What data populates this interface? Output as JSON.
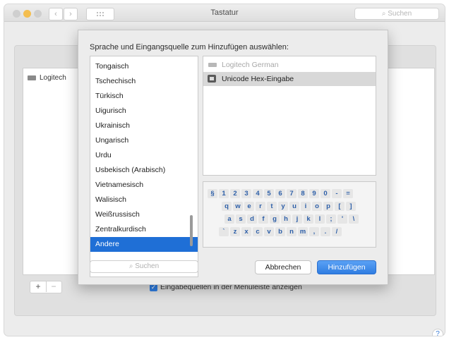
{
  "window": {
    "title": "Tastatur",
    "search_placeholder": "Suchen"
  },
  "background": {
    "list_item": "Logitech",
    "show_in_menu_label": "Eingabequellen in der Menüleiste anzeigen",
    "show_in_menu_checked": true
  },
  "sheet": {
    "prompt": "Sprache und Eingangsquelle zum Hinzufügen auswählen:",
    "languages": [
      "Tongaisch",
      "Tschechisch",
      "Türkisch",
      "Uigurisch",
      "Ukrainisch",
      "Ungarisch",
      "Urdu",
      "Usbekisch (Arabisch)",
      "Vietnamesisch",
      "Walisisch",
      "Weißrussisch",
      "Zentralkurdisch",
      "Andere"
    ],
    "selected_language": "Andere",
    "sources": {
      "dim_item": "Logitech German",
      "selected_item": "Unicode Hex-Eingabe"
    },
    "keyboard_rows": [
      "§ 1 2 3 4 5 6 7 8 9 0 - =",
      "q w e r t y u i o p [ ]",
      "a s d f g h j k l ; ' \\",
      "` z x c v b n m , . /"
    ],
    "search_placeholder": "Suchen",
    "cancel_label": "Abbrechen",
    "add_label": "Hinzufügen"
  },
  "colors": {
    "accent": "#2f7de1",
    "selection": "#1f6fd6",
    "key_text": "#2d5fa8"
  }
}
